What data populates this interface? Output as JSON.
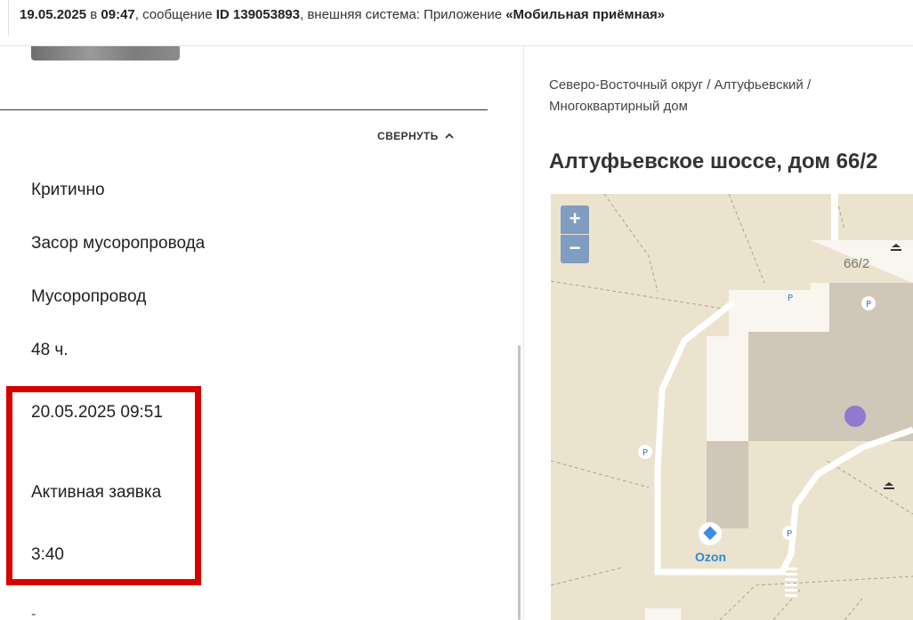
{
  "header": {
    "date": "19.05.2025",
    "sep_at": " в ",
    "time": "09:47",
    "sep_msg": ", сообщение ",
    "message_id": "ID 139053893",
    "sep_sys": ", внешняя система: Приложение ",
    "system_name": "«Мобильная приёмная»"
  },
  "details": {
    "collapse_label": "СВЕРНУТЬ",
    "fields": {
      "priority": "Критично",
      "problem": "Засор мусоропровода",
      "category": "Мусоропровод",
      "deadline": "48 ч.",
      "due_date": "20.05.2025 09:51",
      "status": "Активная заявка",
      "time_left": "3:40",
      "dash": "-"
    }
  },
  "location": {
    "breadcrumb": "Северо-Восточный округ / Алтуфьевский / Многоквартирный дом",
    "address": "Алтуфьевское шоссе, дом 66/2"
  },
  "map": {
    "zoom_in": "+",
    "zoom_out": "−",
    "house_number": "66/2",
    "poi_ozon": "Ozon",
    "parking": "P",
    "colors": {
      "ground": "#ece3cf",
      "building": "#f8f6ee",
      "roof": "#cfc7b8",
      "marker": "#9278d0",
      "highlight": "#d60000"
    }
  }
}
